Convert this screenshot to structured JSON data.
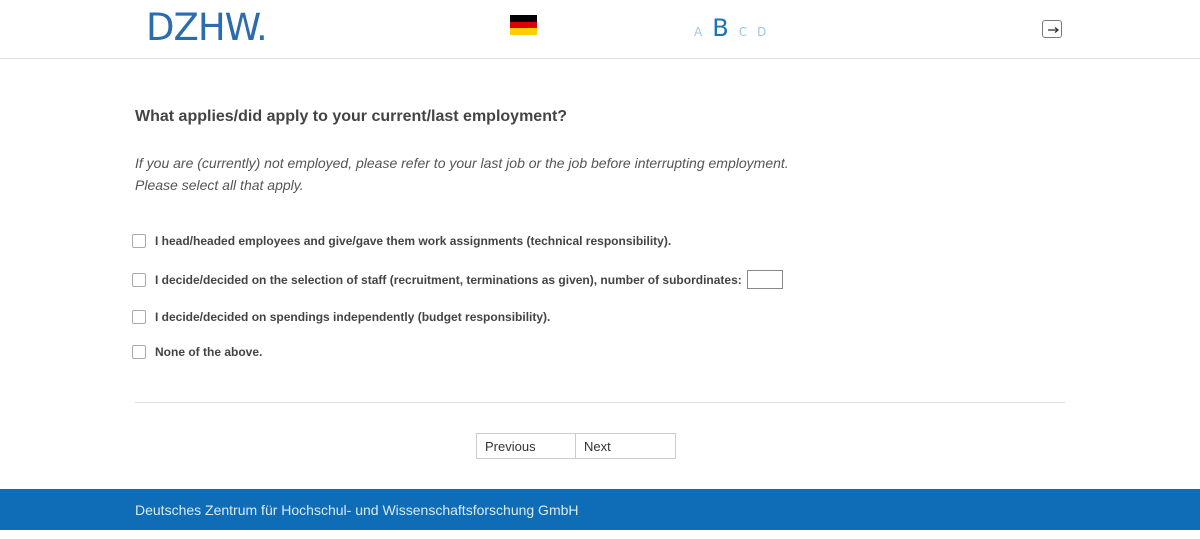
{
  "header": {
    "logo_text": "DZHW.",
    "flag_colors": [
      "#000000",
      "#dd0000",
      "#ffce00"
    ],
    "font_size_options": [
      "A",
      "B",
      "C",
      "D"
    ],
    "active_font_size": "B",
    "exit_icon": "exit-icon"
  },
  "question": {
    "title": "What applies/did apply to your current/last employment?",
    "instruction_line1": "If you are (currently) not employed, please refer to your last job or the job before interrupting employment.",
    "instruction_line2": "Please select all that apply."
  },
  "options": [
    {
      "label": "I head/headed employees and give/gave them work assignments (technical responsibility).",
      "checked": false
    },
    {
      "label": "I decide/decided on the selection of staff (recruitment, terminations as given), number of subordinates:",
      "checked": false,
      "input_value": ""
    },
    {
      "label": "I decide/decided on spendings independently (budget responsibility).",
      "checked": false
    },
    {
      "label": "None of the above.",
      "checked": false
    }
  ],
  "navigation": {
    "previous_label": "Previous",
    "next_label": "Next"
  },
  "footer": {
    "text": "Deutsches Zentrum für Hochschul- und Wissenschaftsforschung GmbH",
    "background_color": "#0f6cb6"
  }
}
